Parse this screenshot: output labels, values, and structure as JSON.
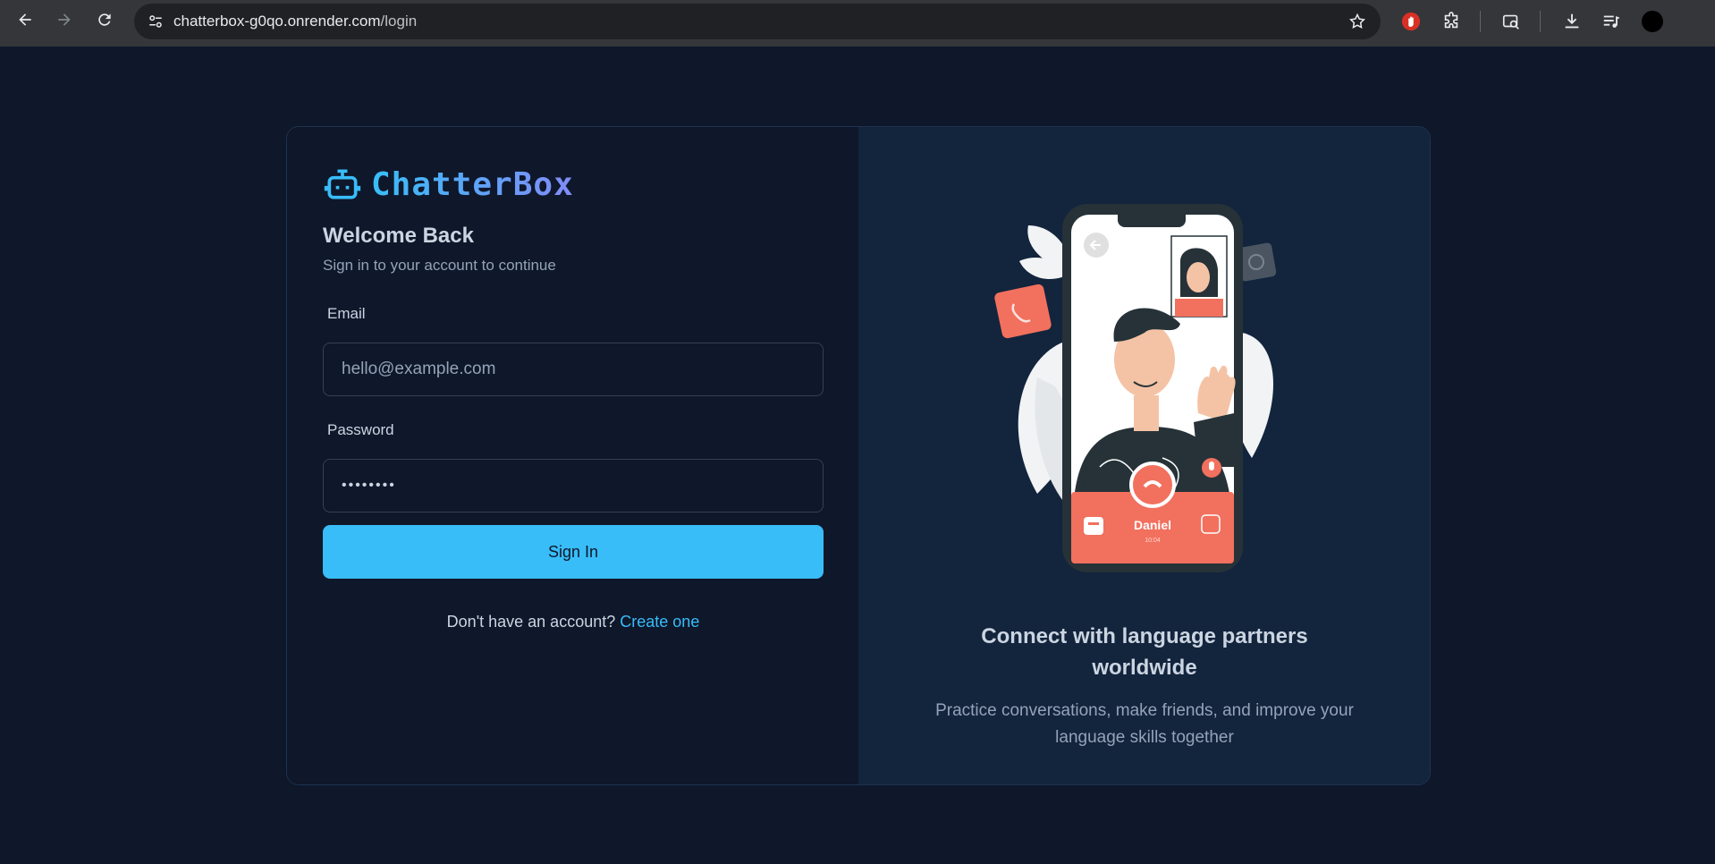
{
  "browser": {
    "url_host": "chatterbox-g0qo.onrender.com",
    "url_path": "/login"
  },
  "login": {
    "brand": "ChatterBox",
    "welcome_title": "Welcome Back",
    "welcome_subtitle": "Sign in to your account to continue",
    "email_label": "Email",
    "email_placeholder": "hello@example.com",
    "password_label": "Password",
    "password_value": "••••••••",
    "signin_label": "Sign In",
    "no_account_text": "Don't have an account?",
    "create_link": "Create one"
  },
  "promo": {
    "illustration_name": "Daniel",
    "illustration_time": "10:04",
    "title": "Connect with language partners worldwide",
    "subtitle": "Practice conversations, make friends, and improve your language skills together"
  },
  "colors": {
    "accent": "#38bdf8",
    "page_bg": "#0f172a",
    "panel_bg": "#13243d",
    "illustration_accent": "#f2705e"
  }
}
